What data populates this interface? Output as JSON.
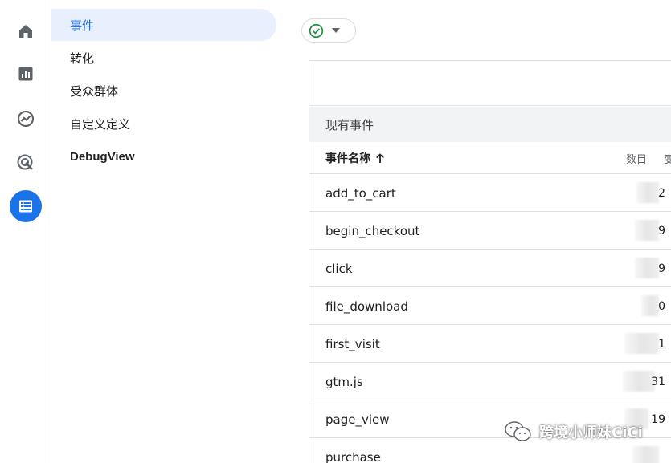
{
  "rail": {
    "items": [
      {
        "icon": "home-icon"
      },
      {
        "icon": "reports-icon"
      },
      {
        "icon": "explore-icon"
      },
      {
        "icon": "advertising-icon"
      },
      {
        "icon": "configure-icon",
        "active": true
      }
    ]
  },
  "subnav": {
    "items": [
      {
        "label": "事件",
        "active": true
      },
      {
        "label": "转化"
      },
      {
        "label": "受众群体"
      },
      {
        "label": "自定义定义"
      },
      {
        "label": "DebugView"
      }
    ]
  },
  "main": {
    "status_chip": {
      "icon": "check-circle-icon"
    },
    "section_title": "现有事件",
    "table": {
      "col_name": "事件名称",
      "sort_icon": "arrow-up-icon",
      "col_count": "数目",
      "col_cut": "变",
      "rows": [
        {
          "name": "add_to_cart",
          "count_tail": "2"
        },
        {
          "name": "begin_checkout",
          "count_tail": "9"
        },
        {
          "name": "click",
          "count_tail": "9"
        },
        {
          "name": "file_download",
          "count_tail": "0"
        },
        {
          "name": "first_visit",
          "count_tail": "1"
        },
        {
          "name": "gtm.js",
          "count_tail": "31"
        },
        {
          "name": "page_view",
          "count_tail": "19"
        },
        {
          "name": "purchase",
          "count_tail": ""
        }
      ]
    }
  },
  "watermark": {
    "text": "跨境小师妹CiCi",
    "icon": "wechat-icon"
  },
  "colors": {
    "accent": "#1a73e8",
    "active_bg": "#e8f0fe",
    "active_text": "#1967d2",
    "check": "#1e8e3e"
  }
}
